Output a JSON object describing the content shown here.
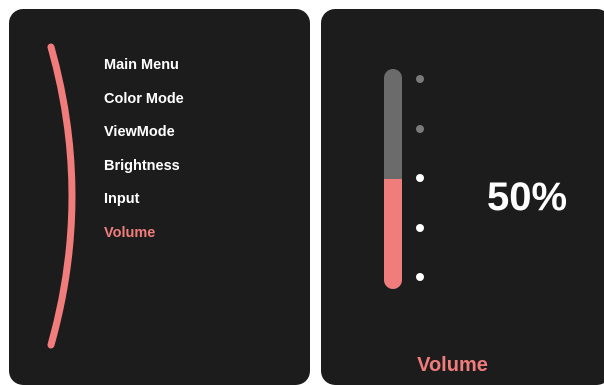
{
  "menu": {
    "items": [
      {
        "label": "Main Menu",
        "active": false
      },
      {
        "label": "Color Mode",
        "active": false
      },
      {
        "label": "ViewMode",
        "active": false
      },
      {
        "label": "Brightness",
        "active": false
      },
      {
        "label": "Input",
        "active": false
      },
      {
        "label": "Volume",
        "active": true
      }
    ]
  },
  "volume": {
    "value_text": "50%",
    "level_fraction": 0.5,
    "title": "Volume",
    "tick_count": 5,
    "lit_ticks": 3
  },
  "colors": {
    "panel_bg": "#1c1c1c",
    "accent": "#f07c7c",
    "track": "#6b6b6b",
    "text": "#ffffff"
  }
}
